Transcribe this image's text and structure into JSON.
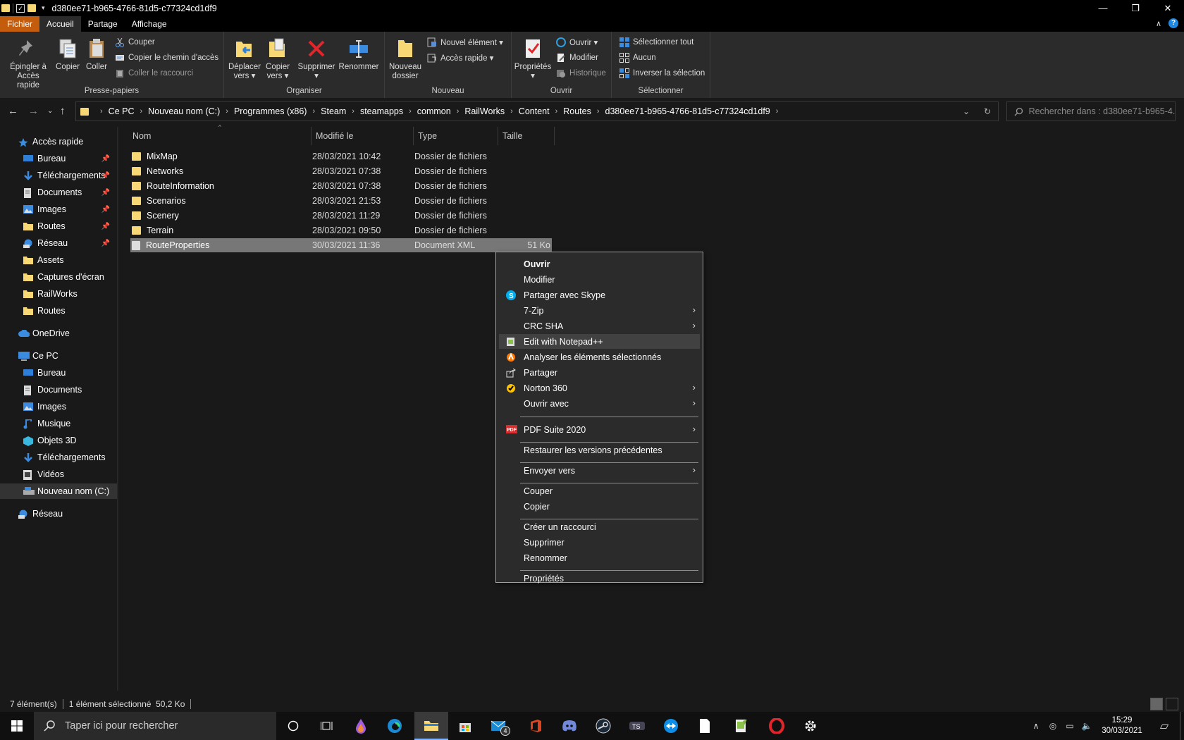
{
  "window": {
    "title": "d380ee71-b965-4766-81d5-c77324cd1df9",
    "controls": {
      "minimize": "—",
      "maximize": "❐",
      "close": "✕"
    }
  },
  "ribbon_tabs": [
    {
      "label": "Fichier"
    },
    {
      "label": "Accueil"
    },
    {
      "label": "Partage"
    },
    {
      "label": "Affichage"
    }
  ],
  "ribbon": {
    "clipboard": {
      "pin_label_1": "Épingler à",
      "pin_label_2": "Accès rapide",
      "copy": "Copier",
      "paste": "Coller",
      "cut": "Couper",
      "copy_path": "Copier le chemin d'accès",
      "paste_shortcut": "Coller le raccourci",
      "group": "Presse-papiers"
    },
    "organize": {
      "move_1": "Déplacer",
      "move_2": "vers",
      "copyto_1": "Copier",
      "copyto_2": "vers",
      "delete": "Supprimer",
      "rename": "Renommer",
      "group": "Organiser"
    },
    "new": {
      "new_folder_1": "Nouveau",
      "new_folder_2": "dossier",
      "new_item": "Nouvel élément",
      "easy_access": "Accès rapide",
      "group": "Nouveau"
    },
    "open": {
      "properties": "Propriétés",
      "open": "Ouvrir",
      "edit": "Modifier",
      "history": "Historique",
      "group": "Ouvrir"
    },
    "select": {
      "select_all": "Sélectionner tout",
      "select_none": "Aucun",
      "invert": "Inverser la sélection",
      "group": "Sélectionner"
    }
  },
  "address": {
    "crumbs": [
      "Ce PC",
      "Nouveau nom (C:)",
      "Programmes (x86)",
      "Steam",
      "steamapps",
      "common",
      "RailWorks",
      "Content",
      "Routes",
      "d380ee71-b965-4766-81d5-c77324cd1df9"
    ],
    "search_placeholder": "Rechercher dans : d380ee71-b965-4..."
  },
  "sidebar": {
    "quick_access": "Accès rapide",
    "quick_items": [
      "Bureau",
      "Téléchargements",
      "Documents",
      "Images",
      "Routes",
      "Réseau",
      "Assets",
      "Captures d'écran",
      "RailWorks",
      "Routes"
    ],
    "onedrive": "OneDrive",
    "this_pc": "Ce PC",
    "pc_items": [
      "Bureau",
      "Documents",
      "Images",
      "Musique",
      "Objets 3D",
      "Téléchargements",
      "Vidéos",
      "Nouveau nom (C:)"
    ],
    "network": "Réseau"
  },
  "columns": {
    "name": "Nom",
    "modified": "Modifié le",
    "type": "Type",
    "size": "Taille"
  },
  "files": [
    {
      "name": "MixMap",
      "date": "28/03/2021 10:42",
      "type": "Dossier de fichiers",
      "size": ""
    },
    {
      "name": "Networks",
      "date": "28/03/2021 07:38",
      "type": "Dossier de fichiers",
      "size": ""
    },
    {
      "name": "RouteInformation",
      "date": "28/03/2021 07:38",
      "type": "Dossier de fichiers",
      "size": ""
    },
    {
      "name": "Scenarios",
      "date": "28/03/2021 21:53",
      "type": "Dossier de fichiers",
      "size": ""
    },
    {
      "name": "Scenery",
      "date": "28/03/2021 11:29",
      "type": "Dossier de fichiers",
      "size": ""
    },
    {
      "name": "Terrain",
      "date": "28/03/2021 09:50",
      "type": "Dossier de fichiers",
      "size": ""
    },
    {
      "name": "RouteProperties",
      "date": "30/03/2021 11:36",
      "type": "Document XML",
      "size": "51 Ko"
    }
  ],
  "context_menu": [
    "Ouvrir",
    "Modifier",
    "Partager avec Skype",
    "7-Zip",
    "CRC SHA",
    "Edit with Notepad++",
    "Analyser les éléments sélectionnés",
    "Partager",
    "Norton 360",
    "Ouvrir avec",
    "PDF Suite 2020",
    "Restaurer les versions précédentes",
    "Envoyer vers",
    "Couper",
    "Copier",
    "Créer un raccourci",
    "Supprimer",
    "Renommer",
    "Propriétés"
  ],
  "status": {
    "count": "7 élément(s)",
    "selected": "1 élément sélectionné  50,2 Ko"
  },
  "taskbar": {
    "search_placeholder": "Taper ici pour rechercher",
    "mail_badge": "4",
    "time": "15:29",
    "date": "30/03/2021"
  },
  "colors": {
    "file_tab": "#c45c0e",
    "folder": "#f8d775",
    "accent_blue": "#1e88e5"
  }
}
